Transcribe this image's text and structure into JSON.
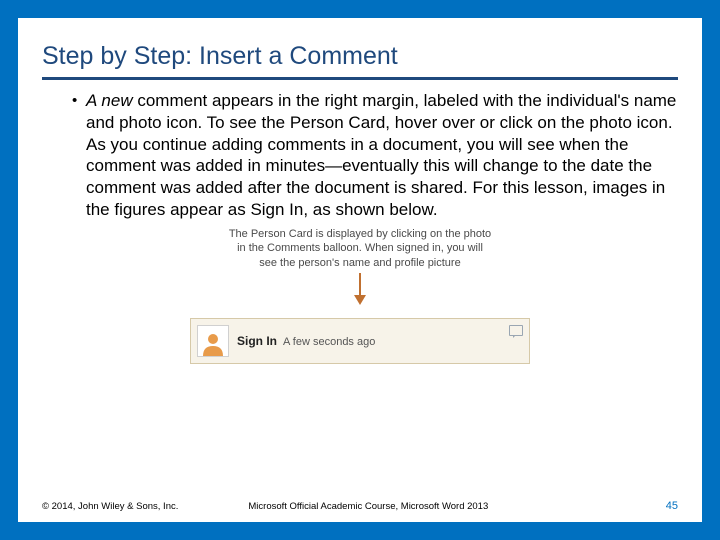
{
  "title": "Step by Step: Insert a Comment",
  "body": {
    "leading_italic": "A new",
    "rest": " comment appears in the right margin, labeled with the individual's name and photo icon. To see the Person Card, hover over or click on the photo icon. As you continue adding comments in a document, you will see when the comment was added in minutes—eventually this will change to the date the comment was added after the document is shared. For this lesson, images in the figures appear as Sign In, as shown below."
  },
  "callout": {
    "line1": "The Person Card is displayed by clicking on the photo",
    "line2": "in the Comments balloon. When signed in, you will",
    "line3": "see the person's name and profile picture"
  },
  "balloon": {
    "signin": "Sign In",
    "ago": "A few seconds ago"
  },
  "footer": {
    "copyright": "© 2014, John Wiley & Sons, Inc.",
    "course": "Microsoft Official Academic Course, Microsoft Word 2013",
    "page": "45"
  }
}
